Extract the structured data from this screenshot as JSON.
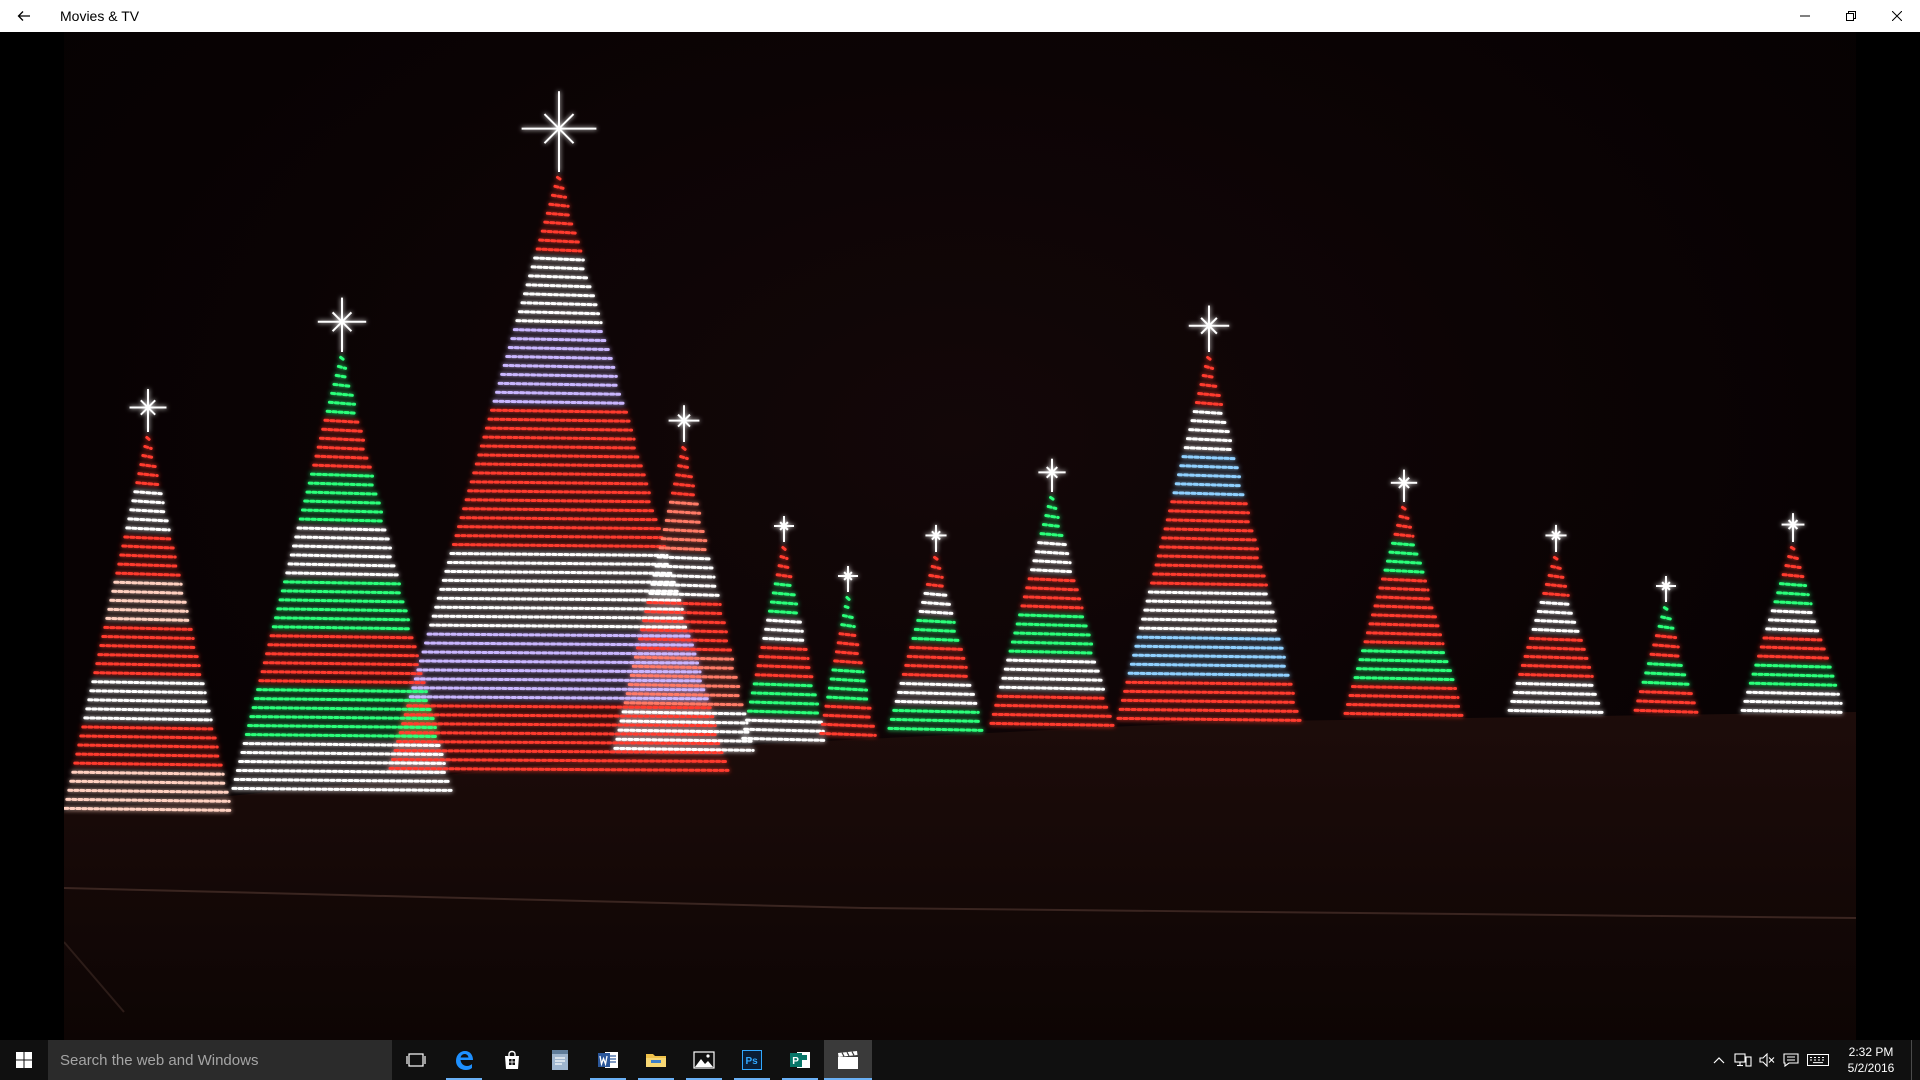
{
  "window": {
    "title": "Movies & TV",
    "back_icon": "back-arrow-icon",
    "controls": [
      "minimize-icon",
      "restore-icon",
      "close-icon"
    ]
  },
  "video": {
    "description_icon": "video-frame"
  },
  "taskbar": {
    "search_placeholder": "Search the web and Windows",
    "apps": [
      {
        "name": "task-view",
        "icon": "task-view-icon"
      },
      {
        "name": "edge",
        "icon": "edge-icon"
      },
      {
        "name": "store",
        "icon": "store-icon"
      },
      {
        "name": "notepad",
        "icon": "document-app-icon"
      },
      {
        "name": "word",
        "icon": "word-icon"
      },
      {
        "name": "file-explorer",
        "icon": "folder-icon"
      },
      {
        "name": "photos",
        "icon": "photos-icon"
      },
      {
        "name": "photoshop",
        "icon": "photoshop-icon"
      },
      {
        "name": "publisher",
        "icon": "publisher-icon"
      },
      {
        "name": "movies-tv",
        "icon": "clapperboard-icon"
      }
    ],
    "clock": {
      "time": "2:32 PM",
      "date": "5/2/2016"
    },
    "colors": {
      "accent": "#6ab0f5",
      "taskbar_bg": "#101010",
      "search_bg": "#2b2b2b"
    }
  }
}
